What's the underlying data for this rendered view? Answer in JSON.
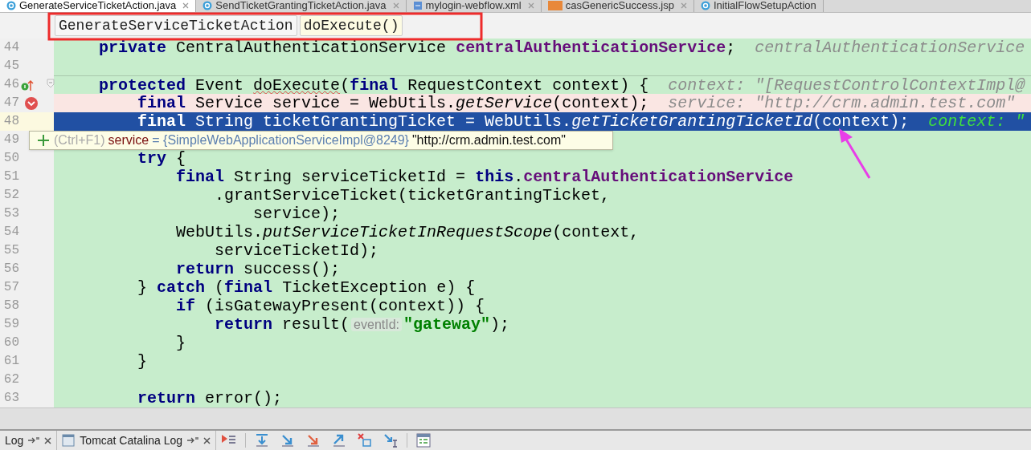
{
  "tabs": [
    {
      "label": "GenerateServiceTicketAction.java",
      "kind": "class",
      "selected": true
    },
    {
      "label": "SendTicketGrantingTicketAction.java",
      "kind": "class",
      "selected": false
    },
    {
      "label": "mylogin-webflow.xml",
      "kind": "xml",
      "selected": false
    },
    {
      "label": "casGenericSuccess.jsp",
      "kind": "jsp",
      "selected": false
    },
    {
      "label": "InitialFlowSetupAction",
      "kind": "class",
      "selected": false
    }
  ],
  "breadcrumb": [
    {
      "label": "GenerateServiceTicketAction",
      "kind": "class"
    },
    {
      "label": "doExecute()",
      "kind": "method"
    }
  ],
  "lines": [
    {
      "number": "44",
      "breakpoint": false,
      "selected": false,
      "segments": [
        {
          "kind": "kw",
          "text": "    private"
        },
        {
          "kind": "plain",
          "text": " CentralAuthenticationService "
        },
        {
          "kind": "field",
          "text": "centralAuthenticationService"
        },
        {
          "kind": "plain",
          "text": ";  "
        },
        {
          "kind": "hint",
          "text": "centralAuthenticationService"
        }
      ]
    },
    {
      "number": "45",
      "breakpoint": false,
      "selected": false
    },
    {
      "number": "46",
      "breakpoint": false,
      "selected": false,
      "implements": true,
      "separator": true,
      "segments": [
        {
          "kind": "kw",
          "text": "    protected"
        },
        {
          "kind": "plain",
          "text": " Event "
        },
        {
          "kind": "warn",
          "text": "doExecute"
        },
        {
          "kind": "plain",
          "text": "("
        },
        {
          "kind": "kw",
          "text": "final"
        },
        {
          "kind": "plain",
          "text": " RequestContext context) {  "
        },
        {
          "kind": "hint",
          "text": "context: \"[RequestControlContextImpl@"
        }
      ]
    },
    {
      "number": "47",
      "breakpoint": true,
      "selected": false,
      "segments": [
        {
          "kind": "kw",
          "text": "        final"
        },
        {
          "kind": "plain",
          "text": " Service service = WebUtils."
        },
        {
          "kind": "call",
          "text": "getService"
        },
        {
          "kind": "plain",
          "text": "(context);  "
        },
        {
          "kind": "hint",
          "text": "service: \"http://crm.admin.test.com\""
        }
      ]
    },
    {
      "number": "48",
      "breakpoint": false,
      "selected": true,
      "segments": [
        {
          "kind": "kw",
          "text": "        final"
        },
        {
          "kind": "plain",
          "text": " String ticketGrantingTicket = WebUtils."
        },
        {
          "kind": "call",
          "text": "getTicketGrantingTicketId"
        },
        {
          "kind": "plain",
          "text": "(context);  "
        },
        {
          "kind": "hint",
          "text": "context: \""
        }
      ]
    },
    {
      "number": "49",
      "breakpoint": false,
      "selected": false
    },
    {
      "number": "50",
      "breakpoint": false,
      "selected": false,
      "segments": [
        {
          "kind": "kw",
          "text": "        try"
        },
        {
          "kind": "plain",
          "text": " {"
        }
      ]
    },
    {
      "number": "51",
      "breakpoint": false,
      "selected": false,
      "segments": [
        {
          "kind": "kw",
          "text": "            final"
        },
        {
          "kind": "plain",
          "text": " String serviceTicketId = "
        },
        {
          "kind": "kw",
          "text": "this"
        },
        {
          "kind": "plain",
          "text": "."
        },
        {
          "kind": "field",
          "text": "centralAuthenticationService"
        }
      ]
    },
    {
      "number": "52",
      "breakpoint": false,
      "selected": false,
      "segments": [
        {
          "kind": "plain",
          "text": "                .grantServiceTicket(ticketGrantingTicket,"
        }
      ]
    },
    {
      "number": "53",
      "breakpoint": false,
      "selected": false,
      "segments": [
        {
          "kind": "plain",
          "text": "                    service);"
        }
      ]
    },
    {
      "number": "54",
      "breakpoint": false,
      "selected": false,
      "segments": [
        {
          "kind": "plain",
          "text": "            WebUtils."
        },
        {
          "kind": "call",
          "text": "putServiceTicketInRequestScope"
        },
        {
          "kind": "plain",
          "text": "(context,"
        }
      ]
    },
    {
      "number": "55",
      "breakpoint": false,
      "selected": false,
      "segments": [
        {
          "kind": "plain",
          "text": "                serviceTicketId);"
        }
      ]
    },
    {
      "number": "56",
      "breakpoint": false,
      "selected": false,
      "segments": [
        {
          "kind": "kw",
          "text": "            return"
        },
        {
          "kind": "plain",
          "text": " success();"
        }
      ]
    },
    {
      "number": "57",
      "breakpoint": false,
      "selected": false,
      "segments": [
        {
          "kind": "plain",
          "text": "        } "
        },
        {
          "kind": "kw",
          "text": "catch"
        },
        {
          "kind": "plain",
          "text": " ("
        },
        {
          "kind": "kw",
          "text": "final"
        },
        {
          "kind": "plain",
          "text": " TicketException e) {"
        }
      ]
    },
    {
      "number": "58",
      "breakpoint": false,
      "selected": false,
      "segments": [
        {
          "kind": "kw",
          "text": "            if"
        },
        {
          "kind": "plain",
          "text": " (isGatewayPresent(context)) {"
        }
      ]
    },
    {
      "number": "59",
      "breakpoint": false,
      "selected": false,
      "segments": [
        {
          "kind": "kw",
          "text": "                return"
        },
        {
          "kind": "plain",
          "text": " result("
        },
        {
          "kind": "param",
          "text": "eventId:"
        },
        {
          "kind": "str",
          "text": "\"gateway\""
        },
        {
          "kind": "plain",
          "text": ");"
        }
      ]
    },
    {
      "number": "60",
      "breakpoint": false,
      "selected": false,
      "segments": [
        {
          "kind": "plain",
          "text": "            }"
        }
      ]
    },
    {
      "number": "61",
      "breakpoint": false,
      "selected": false,
      "segments": [
        {
          "kind": "plain",
          "text": "        }"
        }
      ]
    },
    {
      "number": "62",
      "breakpoint": false,
      "selected": false
    },
    {
      "number": "63",
      "breakpoint": false,
      "selected": false,
      "segments": [
        {
          "kind": "kw",
          "text": "        return"
        },
        {
          "kind": "plain",
          "text": " error();"
        }
      ]
    }
  ],
  "tooltip": {
    "shortcut": "(Ctrl+F1)",
    "name": "service",
    "type": "= {SimpleWebApplicationServiceImpl@8249}",
    "value": "\"http://crm.admin.test.com\""
  },
  "bottom_tabs": [
    {
      "label": "Log",
      "selected": false
    },
    {
      "label": "Tomcat Catalina Log",
      "selected": false
    }
  ]
}
